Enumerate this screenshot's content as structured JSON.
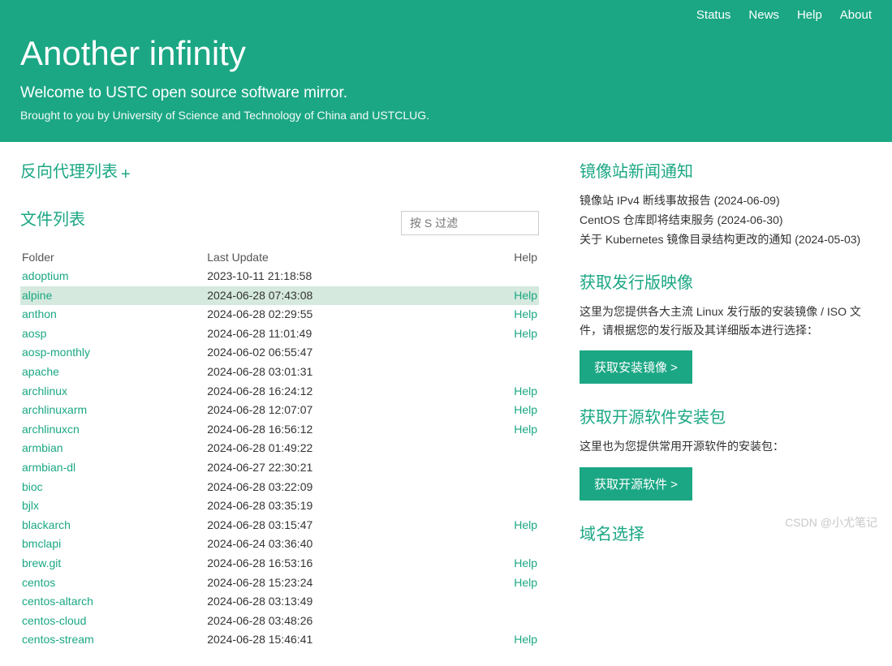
{
  "nav": {
    "status": "Status",
    "news": "News",
    "help": "Help",
    "about": "About"
  },
  "header": {
    "title": "Another infinity",
    "subtitle": "Welcome to USTC open source software mirror.",
    "brought": "Brought to you by University of Science and Technology of China and USTCLUG."
  },
  "proxy": {
    "title": "反向代理列表",
    "plus": "+"
  },
  "filelist": {
    "title": "文件列表",
    "filter_placeholder": "按 S 过滤",
    "col_folder": "Folder",
    "col_update": "Last Update",
    "col_help": "Help",
    "rows": [
      {
        "folder": "adoptium",
        "update": "2023-10-11 21:18:58",
        "help": ""
      },
      {
        "folder": "alpine",
        "update": "2024-06-28 07:43:08",
        "help": "Help",
        "hover": true
      },
      {
        "folder": "anthon",
        "update": "2024-06-28 02:29:55",
        "help": "Help"
      },
      {
        "folder": "aosp",
        "update": "2024-06-28 11:01:49",
        "help": "Help"
      },
      {
        "folder": "aosp-monthly",
        "update": "2024-06-02 06:55:47",
        "help": ""
      },
      {
        "folder": "apache",
        "update": "2024-06-28 03:01:31",
        "help": ""
      },
      {
        "folder": "archlinux",
        "update": "2024-06-28 16:24:12",
        "help": "Help"
      },
      {
        "folder": "archlinuxarm",
        "update": "2024-06-28 12:07:07",
        "help": "Help"
      },
      {
        "folder": "archlinuxcn",
        "update": "2024-06-28 16:56:12",
        "help": "Help"
      },
      {
        "folder": "armbian",
        "update": "2024-06-28 01:49:22",
        "help": ""
      },
      {
        "folder": "armbian-dl",
        "update": "2024-06-27 22:30:21",
        "help": ""
      },
      {
        "folder": "bioc",
        "update": "2024-06-28 03:22:09",
        "help": ""
      },
      {
        "folder": "bjlx",
        "update": "2024-06-28 03:35:19",
        "help": ""
      },
      {
        "folder": "blackarch",
        "update": "2024-06-28 03:15:47",
        "help": "Help"
      },
      {
        "folder": "bmclapi",
        "update": "2024-06-24 03:36:40",
        "help": ""
      },
      {
        "folder": "brew.git",
        "update": "2024-06-28 16:53:16",
        "help": "Help"
      },
      {
        "folder": "centos",
        "update": "2024-06-28 15:23:24",
        "help": "Help"
      },
      {
        "folder": "centos-altarch",
        "update": "2024-06-28 03:13:49",
        "help": ""
      },
      {
        "folder": "centos-cloud",
        "update": "2024-06-28 03:48:26",
        "help": ""
      },
      {
        "folder": "centos-stream",
        "update": "2024-06-28 15:46:41",
        "help": "Help"
      }
    ]
  },
  "side": {
    "news_title": "镜像站新闻通知",
    "news": [
      "镜像站 IPv4 断线事故报告 (2024-06-09)",
      "CentOS 仓库即将结束服务 (2024-06-30)",
      "关于 Kubernetes 镜像目录结构更改的通知 (2024-05-03)"
    ],
    "distro_title": "获取发行版映像",
    "distro_desc": "这里为您提供各大主流 Linux 发行版的安装镜像 / ISO 文件，请根据您的发行版及其详细版本进行选择：",
    "distro_btn": "获取安装镜像 >",
    "soft_title": "获取开源软件安装包",
    "soft_desc": "这里也为您提供常用开源软件的安装包：",
    "soft_btn": "获取开源软件 >",
    "domain_title": "域名选择"
  },
  "watermark": "CSDN @小尤笔记"
}
